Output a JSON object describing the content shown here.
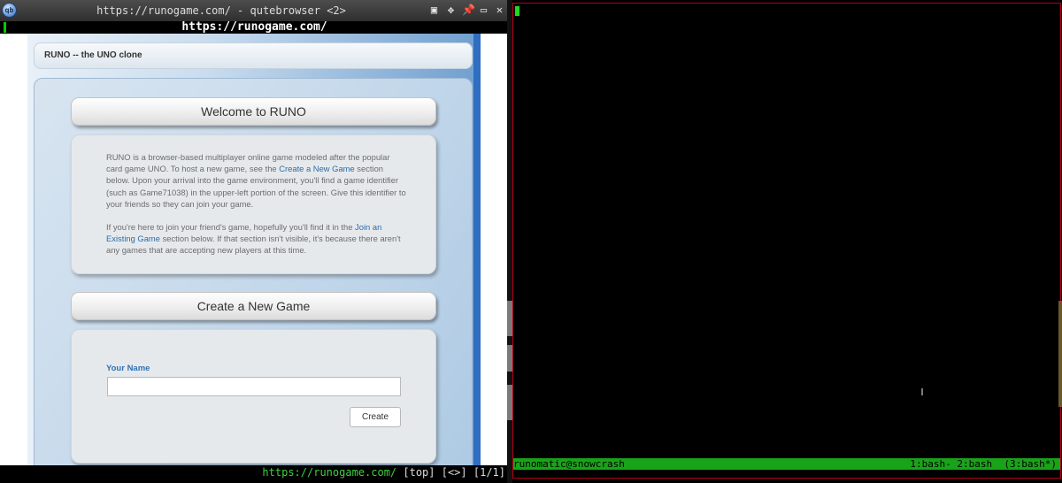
{
  "browser": {
    "window_title": "https://runogame.com/ - qutebrowser <2>",
    "logo_text": "qb",
    "url": "https://runogame.com/",
    "status": {
      "url": "https://runogame.com/",
      "scroll": "[top]",
      "history": "[<>]",
      "tabs": "[1/1]"
    }
  },
  "page": {
    "header_title": "RUNO -- the UNO clone",
    "welcome": {
      "heading": "Welcome to RUNO",
      "para1_pre": "RUNO is a browser-based multiplayer online game modeled after the popular card game UNO. To host a new game, see the ",
      "para1_link": "Create a New Game",
      "para1_post": " section below. Upon your arrival into the game environment, you'll find a game identifier (such as Game71038) in the upper-left portion of the screen. Give this identifier to your friends so they can join your game.",
      "para2_pre": "If you're here to join your friend's game, hopefully you'll find it in the ",
      "para2_link": "Join an Existing Game",
      "para2_post": " section below. If that section isn't visible, it's because there aren't any games that are accepting new players at this time."
    },
    "create": {
      "heading": "Create a New Game",
      "name_label": "Your Name",
      "name_value": "",
      "button_label": "Create"
    }
  },
  "terminal": {
    "session": "runomatic@snowcrash",
    "windows": "1:bash- 2:bash  (3:bash*)"
  },
  "colors": {
    "link": "#2b6ca8",
    "label_blue": "#2f73b3",
    "status_green": "#19a319",
    "border_red": "#b3001a"
  }
}
